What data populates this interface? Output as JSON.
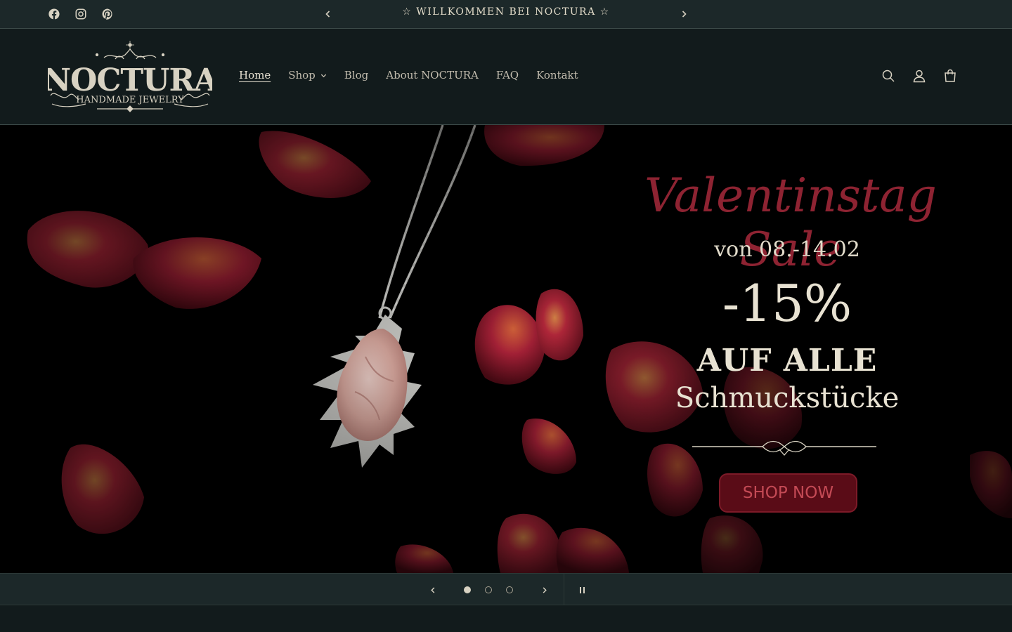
{
  "announcement": {
    "text": "☆ WILLKOMMEN BEI NOCTURA ☆",
    "prev_icon": "chevron-left-icon",
    "next_icon": "chevron-right-icon"
  },
  "social": [
    {
      "name": "facebook",
      "icon": "facebook-icon"
    },
    {
      "name": "instagram",
      "icon": "instagram-icon"
    },
    {
      "name": "pinterest",
      "icon": "pinterest-icon"
    }
  ],
  "logo": {
    "brand": "NOCTURA",
    "tagline": "HANDMADE JEWELRY"
  },
  "nav": {
    "items": [
      {
        "label": "Home",
        "active": true
      },
      {
        "label": "Shop",
        "has_dropdown": true
      },
      {
        "label": "Blog"
      },
      {
        "label": "About NOCTURA"
      },
      {
        "label": "FAQ"
      },
      {
        "label": "Kontakt"
      }
    ]
  },
  "header_icons": [
    "search-icon",
    "account-icon",
    "cart-icon"
  ],
  "hero": {
    "title": "Valentinstag Sale",
    "dates": "von 08.-14.02",
    "discount": "-15%",
    "line1": "AUF ALLE",
    "line2": "Schmuckstücke",
    "cta": "SHOP NOW"
  },
  "slider": {
    "slides": 3,
    "active_slide": 1,
    "paused": false
  },
  "colors": {
    "background": "#121b1c",
    "bar": "#1c2829",
    "text": "#d8d2c2",
    "accent_red": "#8e2332",
    "cta_bg": "#5a0c17"
  }
}
